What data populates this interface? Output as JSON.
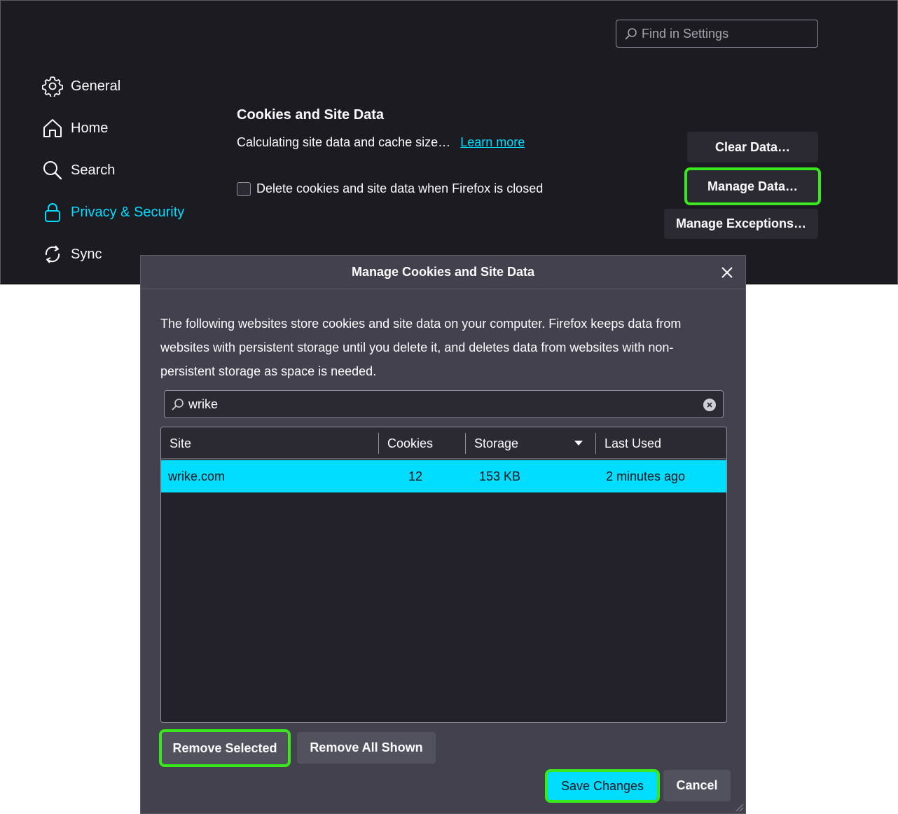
{
  "settings": {
    "find_placeholder": "Find in Settings",
    "nav": [
      {
        "label": "General",
        "icon": "gear-icon"
      },
      {
        "label": "Home",
        "icon": "home-icon"
      },
      {
        "label": "Search",
        "icon": "search-icon"
      },
      {
        "label": "Privacy & Security",
        "icon": "lock-icon",
        "active": true
      },
      {
        "label": "Sync",
        "icon": "sync-icon"
      }
    ],
    "section_title": "Cookies and Site Data",
    "section_desc": "Calculating site data and cache size…",
    "learn_more": "Learn more",
    "delete_checkbox_label": "Delete cookies and site data when Firefox is closed",
    "clear_data_button": "Clear Data…",
    "manage_data_button": "Manage Data…",
    "manage_exceptions_button": "Manage Exceptions…"
  },
  "dialog": {
    "title": "Manage Cookies and Site Data",
    "description": "The following websites store cookies and site data on your computer. Firefox keeps data from websites with persistent storage until you delete it, and deletes data from websites with non-persistent storage as space is needed.",
    "search_value": "wrike",
    "columns": [
      "Site",
      "Cookies",
      "Storage",
      "Last Used"
    ],
    "rows": [
      {
        "site": "wrike.com",
        "cookies": "12",
        "storage": "153 KB",
        "last_used": "2 minutes ago"
      }
    ],
    "remove_selected": "Remove Selected",
    "remove_all_shown": "Remove All Shown",
    "save_changes": "Save Changes",
    "cancel": "Cancel"
  },
  "colors": {
    "accent": "#00ddff",
    "highlight": "#39e81c",
    "background": "#1c1b22",
    "dialog": "#42414d"
  }
}
